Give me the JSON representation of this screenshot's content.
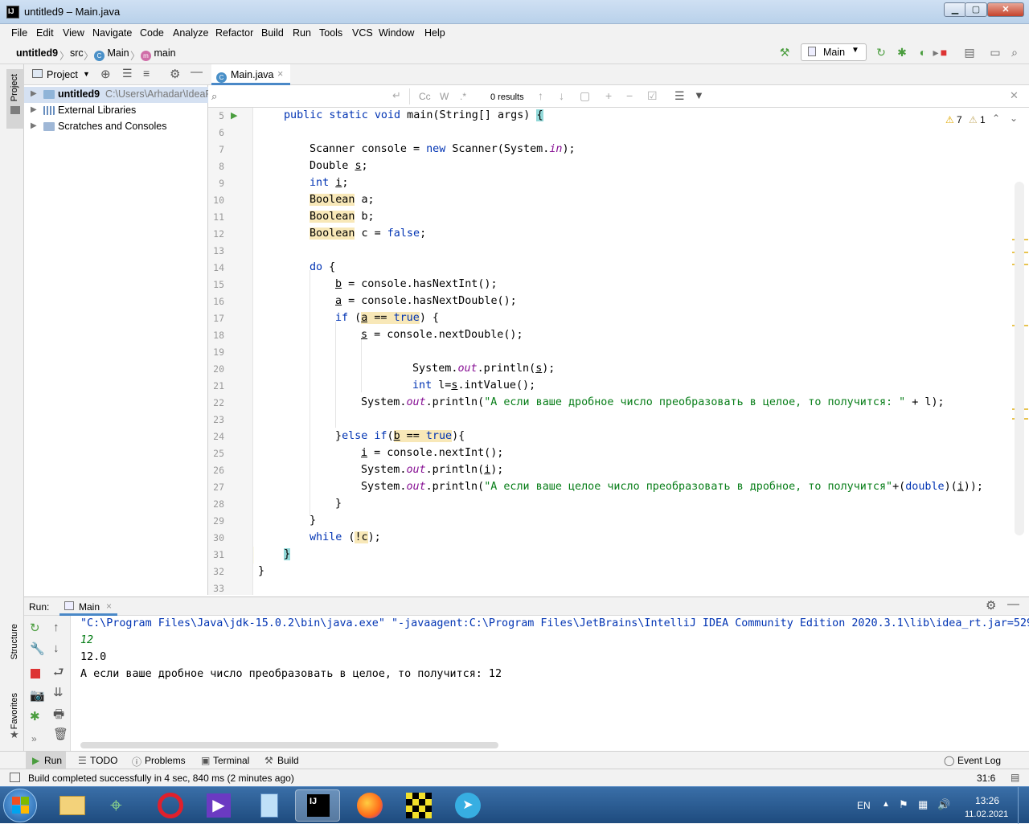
{
  "window": {
    "title": "untitled9 – Main.java",
    "min": "▁",
    "max": "▢",
    "close": "✕"
  },
  "menu": [
    "File",
    "Edit",
    "View",
    "Navigate",
    "Code",
    "Analyze",
    "Refactor",
    "Build",
    "Run",
    "Tools",
    "VCS",
    "Window",
    "Help"
  ],
  "breadcrumb": {
    "project": "untitled9",
    "src": "src",
    "cls": "Main",
    "method": "main"
  },
  "run_config": "Main",
  "project_panel": {
    "title": "Project",
    "tree": [
      {
        "name": "untitled9",
        "path": "C:\\Users\\Arhadar\\IdeaPr"
      },
      {
        "name": "External Libraries"
      },
      {
        "name": "Scratches and Consoles"
      }
    ]
  },
  "side_tabs": {
    "project": "Project",
    "structure": "Structure",
    "favorites": "Favorites"
  },
  "editor_tab": "Main.java",
  "search": {
    "placeholder": "",
    "cc": "Cc",
    "w": "W",
    "regex": ".*",
    "results": "0 results"
  },
  "inspections": {
    "warnings": "7",
    "weak": "1"
  },
  "code": {
    "l5": "public static void main(String[] args) {",
    "l7a": "Scanner console = ",
    "l7b": "new",
    "l7c": " Scanner(System.",
    "l7d": "in",
    "l7e": ");",
    "l8": "Double s;",
    "l9a": "int",
    "l9b": " i;",
    "l10a": "Boolean",
    "l10b": " a;",
    "l11a": "Boolean",
    "l11b": " b;",
    "l12a": "Boolean",
    "l12b": " c = ",
    "l12c": "false",
    ";": ";",
    "l14a": "do",
    "l14b": " {",
    "l15": "b = console.hasNextInt();",
    "l16": "a = console.hasNextDouble();",
    "l17a": "if",
    "l17b": " (",
    "l17c": "a",
    "l17d": " == ",
    "l17e": "true",
    "l17f": ") {",
    "l18": "s = console.nextDouble();",
    "l20a": "System.",
    "l20b": "out",
    "l20c": ".println(s);",
    "l21a": "int",
    "l21b": " l=s.intValue();",
    "l22a": "System.",
    "l22b": "out",
    "l22c": ".println(",
    "l22d": "\"А если ваше дробное число преобразовать в целое, то получится: \"",
    "l22e": " + l);",
    "l24a": "}",
    "l24b": "else if",
    "l24c": "(",
    "l24d": "b == true",
    "l24e": "){",
    "l25": "i = console.nextInt();",
    "l26a": "System.",
    "l26b": "out",
    "l26c": ".println(i);",
    "l27a": "System.",
    "l27b": "out",
    "l27c": ".println(",
    "l27d": "\"А если ваше целое число преобразовать в дробное, то получится\"",
    "l27e": "+(",
    "l27f": "double",
    "l27g": ")(i));",
    "l28": "}",
    "l29": "}",
    "l30a": "while",
    "l30b": " (",
    "l30c": "!c",
    "l30d": ");",
    "l31": "}",
    "l32": "}"
  },
  "run": {
    "label": "Run:",
    "tab": "Main",
    "lines": [
      "\"C:\\Program Files\\Java\\jdk-15.0.2\\bin\\java.exe\" \"-javaagent:C:\\Program Files\\JetBrains\\IntelliJ IDEA Community Edition 2020.3.1\\lib\\idea_rt.jar=529",
      "12",
      "12.0",
      "А если ваше дробное число преобразовать в целое, то получится: 12"
    ]
  },
  "bottom_tabs": {
    "run": "Run",
    "todo": "TODO",
    "problems": "Problems",
    "terminal": "Terminal",
    "build": "Build",
    "eventlog": "Event Log"
  },
  "status": {
    "message": "Build completed successfully in 4 sec, 840 ms (2 minutes ago)",
    "position": "31:6"
  },
  "tray": {
    "lang": "EN",
    "time": "13:26",
    "date": "11.02.2021"
  },
  "colors": {
    "keyword": "#0033b3",
    "string": "#067d17",
    "accent": "#4a88c7"
  }
}
